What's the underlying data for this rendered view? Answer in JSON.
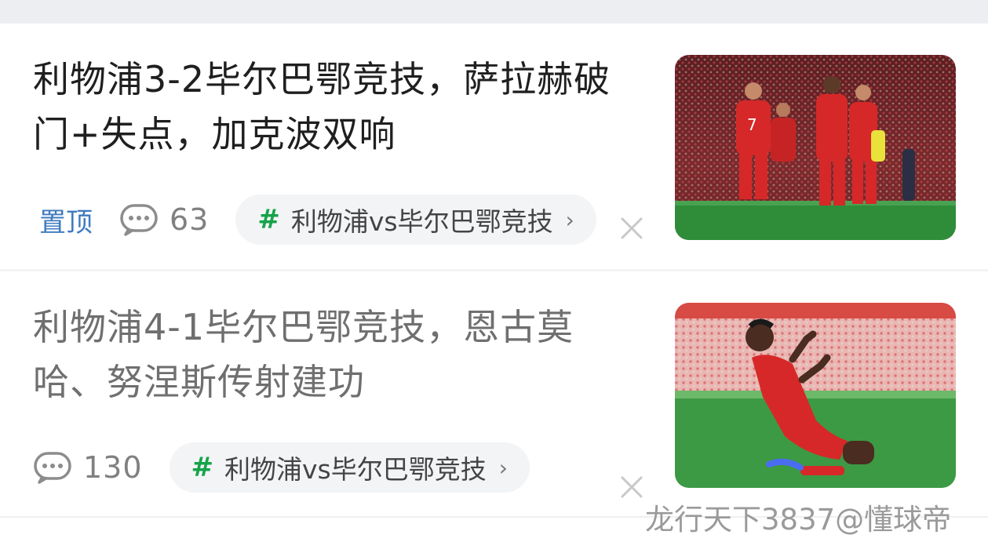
{
  "articles": [
    {
      "title": "利物浦3-2毕尔巴鄂竞技，萨拉赫破门+失点，加克波双响",
      "pin_label": "置顶",
      "comment_count": "63",
      "topic": "利物浦vs毕尔巴鄂竞技",
      "thumbnail": "players-celebrating-red-kits"
    },
    {
      "title": "利物浦4-1毕尔巴鄂竞技，恩古莫哈、努涅斯传射建功",
      "comment_count": "130",
      "topic": "利物浦vs毕尔巴鄂竞技",
      "thumbnail": "player-knee-slide-celebration"
    }
  ],
  "watermark": "龙行天下3837@懂球帝",
  "icons": {
    "comment": "comment-bubble-icon",
    "topic": "hash-icon",
    "chevron": "chevron-right-icon",
    "dismiss": "close-icon"
  },
  "colors": {
    "pin": "#3f7bbf",
    "topic_hash": "#16a34a",
    "kit_red": "#d62828",
    "pitch_green": "#2e8b3a"
  }
}
